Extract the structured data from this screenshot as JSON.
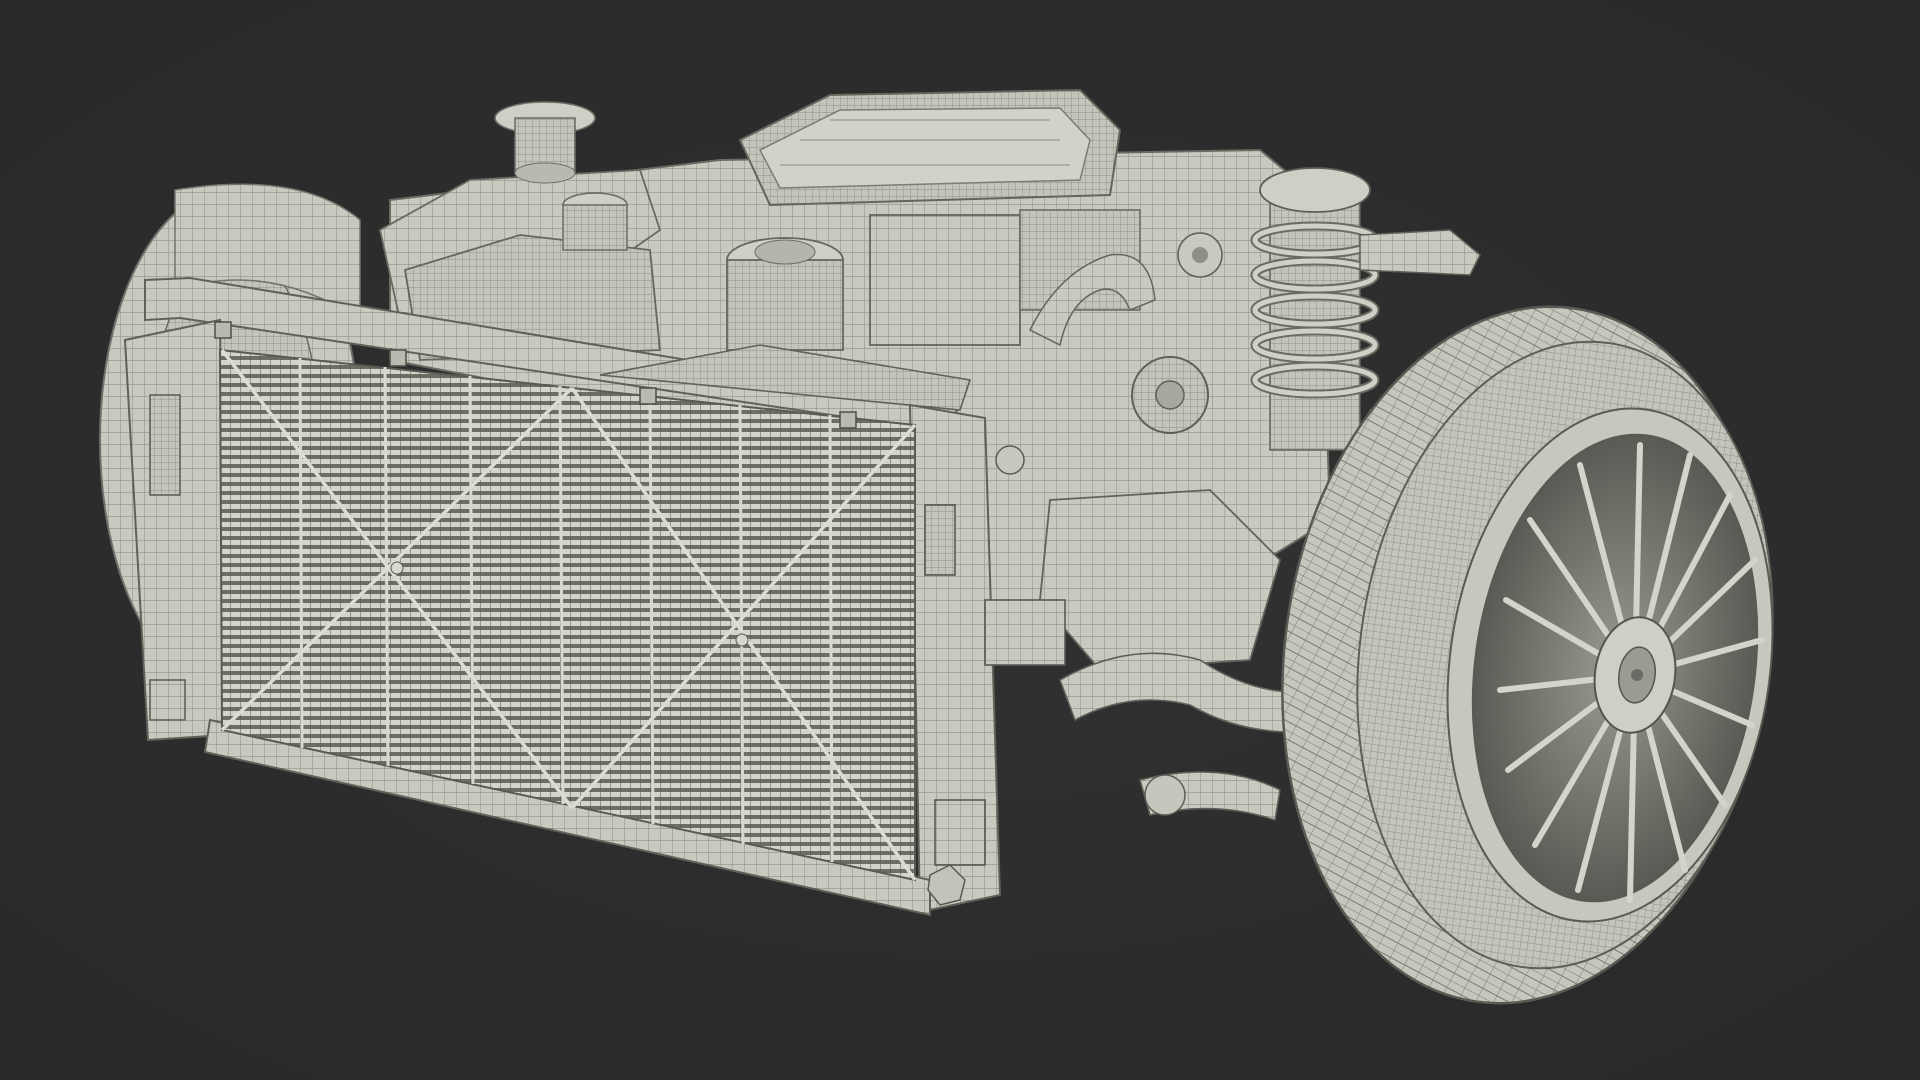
{
  "scene": {
    "background_color": "#2d2d2d",
    "wire_color": "#8e8e86",
    "surface_color": "#cfcfc6",
    "shade_color": "#a9a9a1",
    "dark_color": "#5e5e58",
    "subject": "wireframe-engine-assembly"
  }
}
